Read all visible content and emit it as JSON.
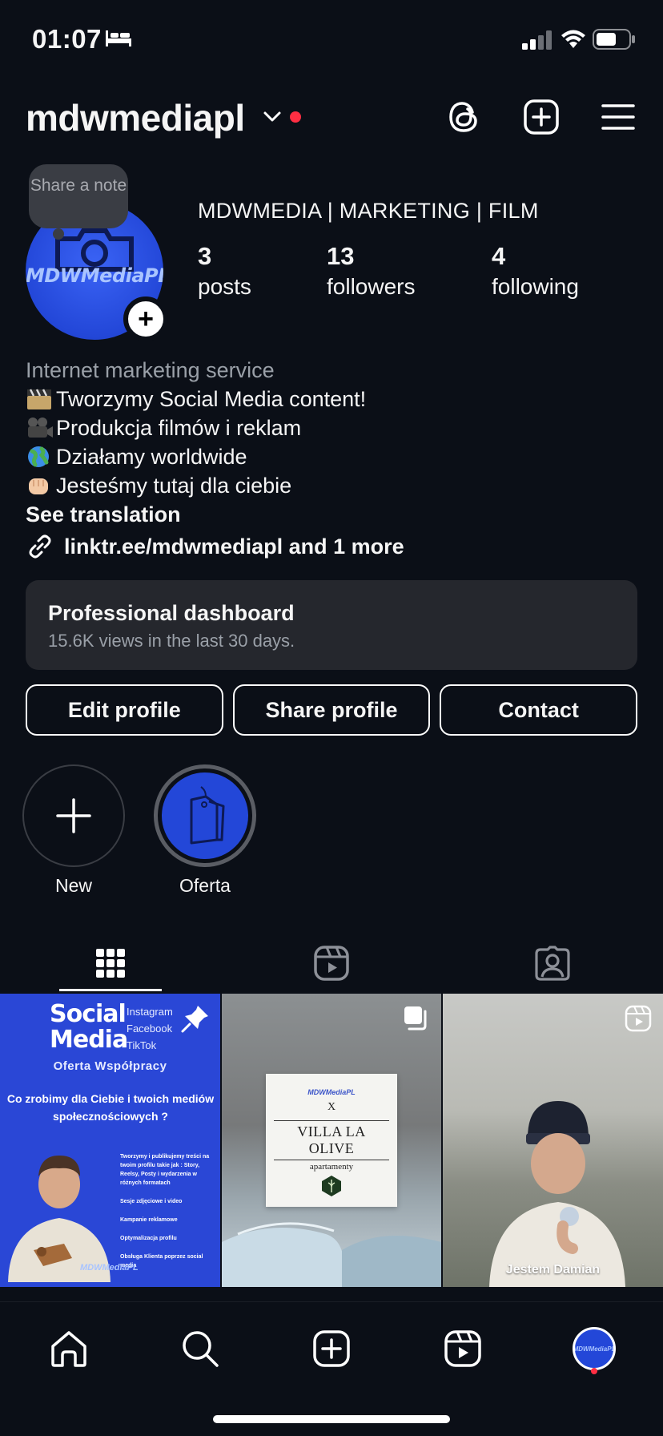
{
  "status_bar": {
    "time": "01:07",
    "icons": [
      "bed-icon",
      "signal-icon",
      "wifi-icon",
      "battery-icon"
    ]
  },
  "header": {
    "username": "mdwmediapl",
    "icons": [
      "chevron-down-icon",
      "threads-icon",
      "create-plus-icon",
      "menu-icon"
    ],
    "accent_dot_color": "#ff2e43"
  },
  "profile": {
    "note_label": "Share a note",
    "avatar_text": "MDWMediaPL",
    "display_name": "MDWMEDIA | MARKETING | FILM",
    "stats": {
      "posts": {
        "value": "3",
        "label": "posts"
      },
      "followers": {
        "value": "13",
        "label": "followers"
      },
      "following": {
        "value": "4",
        "label": "following"
      }
    }
  },
  "bio": {
    "category": "Internet marketing service",
    "lines": [
      {
        "icon": "clapperboard-emoji",
        "text": "Tworzymy Social Media content!"
      },
      {
        "icon": "movie-camera-emoji",
        "text": "Produkcja filmów i reklam"
      },
      {
        "icon": "globe-emoji",
        "text": "Działamy worldwide"
      },
      {
        "icon": "fist-bump-emoji",
        "text": "Jesteśmy tutaj dla ciebie"
      }
    ],
    "see_translation": "See translation",
    "link": "linktr.ee/mdwmediapl and 1 more"
  },
  "dashboard": {
    "title": "Professional dashboard",
    "subtitle": "15.6K views in the last 30 days."
  },
  "buttons": {
    "edit": "Edit profile",
    "share": "Share profile",
    "contact": "Contact"
  },
  "highlights": [
    {
      "label": "New",
      "icon": "plus-icon"
    },
    {
      "label": "Oferta",
      "icon": "price-tag-icon"
    }
  ],
  "tabs": [
    {
      "name": "posts-grid",
      "icon": "grid-icon",
      "active": true
    },
    {
      "name": "reels",
      "icon": "reels-icon",
      "active": false
    },
    {
      "name": "tagged",
      "icon": "tagged-person-icon",
      "active": false
    }
  ],
  "posts": [
    {
      "title_line1": "Social",
      "title_line2": "Media",
      "platforms": [
        "Instagram",
        "Facebook",
        "TikTok"
      ],
      "subtitle": "Oferta Współpracy",
      "question": "Co zrobimy dla Ciebie i twoich mediów społecznościowych ?",
      "services": [
        "Tworzymy i publikujemy treści na twoim profilu takie jak : Story, Reelsy, Posty i wydarzenia w różnych formatach",
        "Sesje zdjęciowe i video",
        "Kampanie reklamowe",
        "Optymalizacja profilu",
        "Obsługa Klienta poprzez social media"
      ],
      "logo": "MDWMediaPL",
      "badge_icon": "pin-icon"
    },
    {
      "logo": "MDWMediaPL",
      "x_text": "X",
      "brand": "VILLA LA OLIVE",
      "brand_sub": "apartamenty",
      "badge_icon": "carousel-icon"
    },
    {
      "caption": "Jestem Damian",
      "badge_icon": "reel-icon"
    }
  ],
  "bottom_nav": {
    "items": [
      "home-icon",
      "search-icon",
      "create-icon",
      "reels-icon",
      "profile-avatar"
    ],
    "notification_dot_color": "#ff2e43"
  },
  "colors": {
    "background": "#0b0f17",
    "card": "#25272d",
    "brand_blue": "#2347d8",
    "text": "#f5f5f5",
    "muted": "#9aa0a8"
  }
}
